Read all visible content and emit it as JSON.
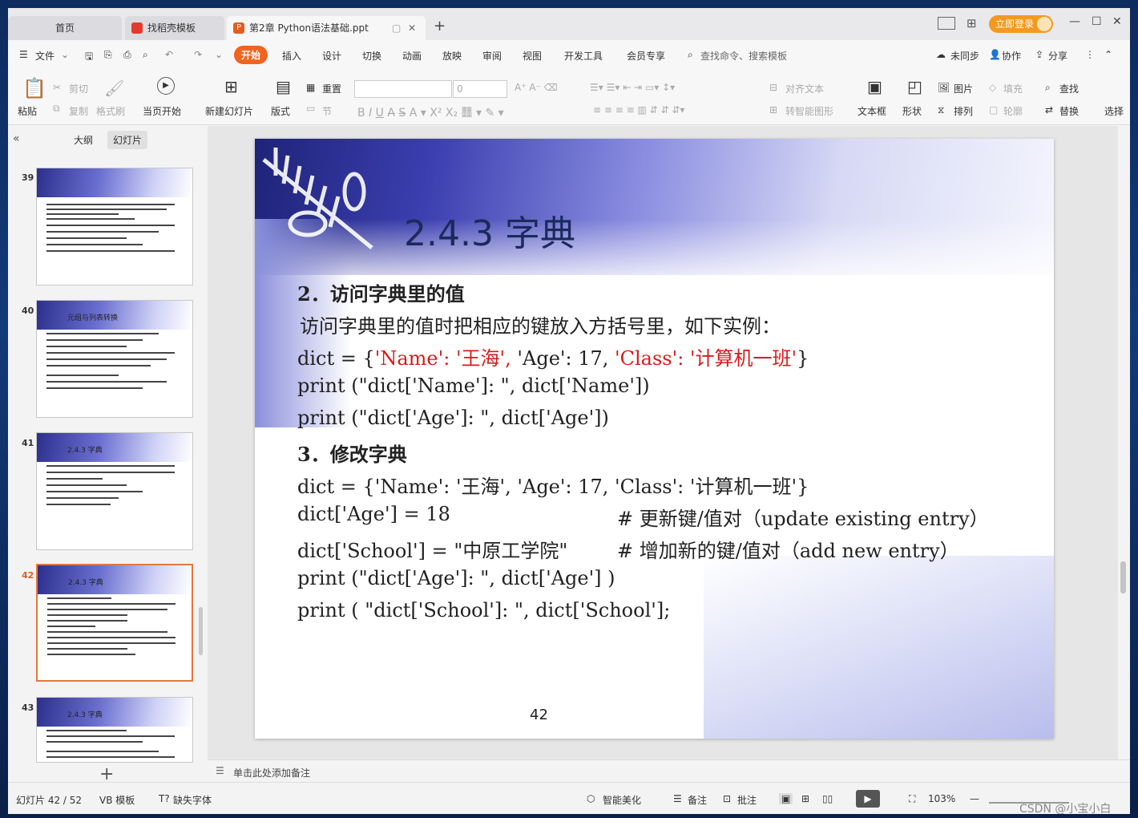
{
  "tabs": {
    "home": "首页",
    "template": "找稻壳模板",
    "doc": "第2章  Python语法基础.ppt",
    "new": "+"
  },
  "window": {
    "login": "立即登录"
  },
  "menu": {
    "file": "文件",
    "items": [
      "开始",
      "插入",
      "设计",
      "切换",
      "动画",
      "放映",
      "审阅",
      "视图",
      "开发工具",
      "会员专享"
    ],
    "search": "查找命令、搜索模板",
    "sync": "未同步",
    "collab": "协作",
    "share": "分享"
  },
  "ribbon": {
    "paste": "粘贴",
    "cut": "剪切",
    "copy": "复制",
    "format_painter": "格式刷",
    "play_current": "当页开始",
    "new_slide": "新建幻灯片",
    "layout": "版式",
    "reset": "重置",
    "section": "节",
    "font_size": "0",
    "align_text": "对齐文本",
    "smart_graphic": "转智能图形",
    "textbox": "文本框",
    "shape": "形状",
    "picture": "图片",
    "fill": "填充",
    "arrange": "排列",
    "outline": "轮廓",
    "find": "查找",
    "replace": "替换",
    "select": "选择"
  },
  "left": {
    "outline_tab": "大纲",
    "slides_tab": "幻灯片",
    "add": "+",
    "thumbs": [
      {
        "num": "39",
        "title": ""
      },
      {
        "num": "40",
        "title": "元组与列表转换"
      },
      {
        "num": "41",
        "title": "2.4.3  字典"
      },
      {
        "num": "42",
        "title": "2.4.3  字典"
      },
      {
        "num": "43",
        "title": "2.4.3  字典"
      }
    ]
  },
  "slide": {
    "title": "2.4.3  字典",
    "h2": "2．访问字典里的值",
    "p1": "访问字典里的值时把相应的键放入方括号里，如下实例：",
    "l1a": "dict = {",
    "l1b": "'Name': '王海',",
    "l1c": " 'Age': 17, ",
    "l1d": "'Class': '计算机一班'",
    "l1e": "}",
    "l2": "print (\"dict['Name']: \", dict['Name'])",
    "l3": "print (\"dict['Age']: \", dict['Age'])",
    "h3": "3．修改字典",
    "l4": "dict = {'Name': '王海', 'Age': 17, 'Class': '计算机一班'}",
    "l5": "dict['Age'] = 18",
    "c5": "# 更新键/值对（update existing entry）",
    "l6": "dict['School'] = \"中原工学院\"",
    "c6": "# 增加新的键/值对（add new entry）",
    "l7": "print (\"dict['Age']: \", dict['Age'] )",
    "l8": "print ( \"dict['School']: \", dict['School'];",
    "page": "42"
  },
  "notes": "单击此处添加备注",
  "status": {
    "slide": "幻灯片 42 / 52",
    "template": "VB 模板",
    "font": "缺失字体",
    "beautify": "智能美化",
    "remarks": "备注",
    "comments": "批注",
    "zoom": "103%",
    "watermark": "CSDN @小宝小白"
  }
}
